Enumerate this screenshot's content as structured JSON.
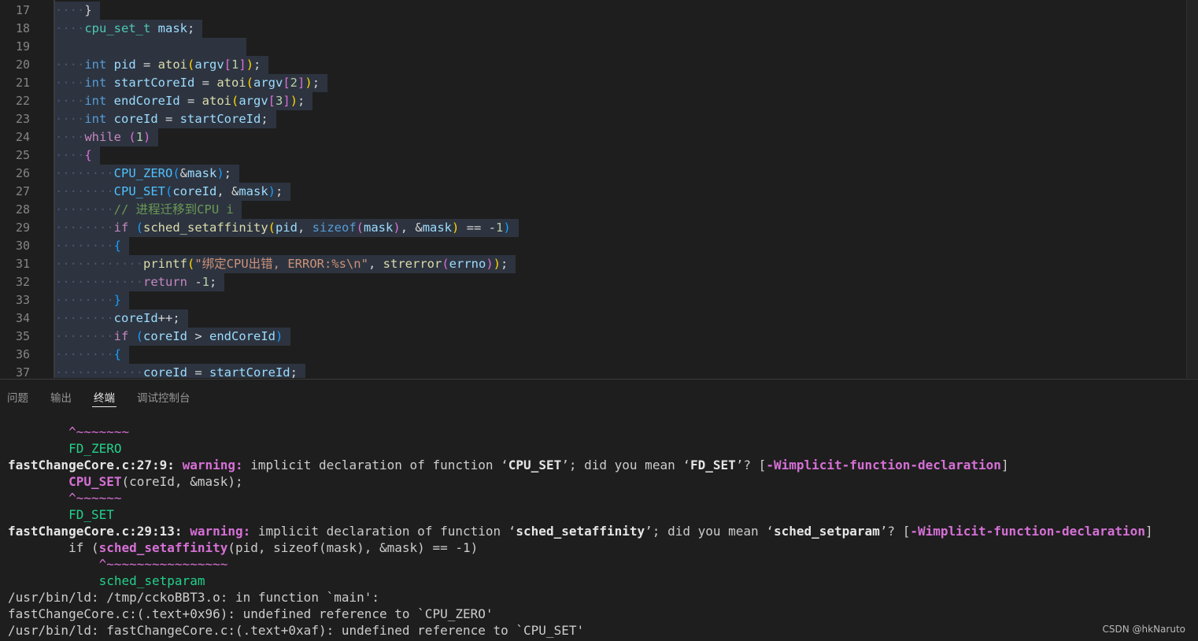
{
  "editor": {
    "line_numbers": [
      "17",
      "18",
      "19",
      "20",
      "21",
      "22",
      "23",
      "24",
      "25",
      "26",
      "27",
      "28",
      "29",
      "30",
      "31",
      "32",
      "33",
      "34",
      "35",
      "36",
      "37"
    ],
    "lines": [
      {
        "indent": 1,
        "tokens": [
          [
            "p",
            "}"
          ]
        ]
      },
      {
        "indent": 1,
        "tokens": [
          [
            "t",
            "cpu_set_t"
          ],
          [
            "p",
            " "
          ],
          [
            "v",
            "mask"
          ],
          [
            "p",
            ";"
          ]
        ]
      },
      {
        "indent": 0,
        "tokens": []
      },
      {
        "indent": 1,
        "tokens": [
          [
            "k",
            "int"
          ],
          [
            "p",
            " "
          ],
          [
            "v",
            "pid"
          ],
          [
            "p",
            " = "
          ],
          [
            "f",
            "atoi"
          ],
          [
            "b1",
            "("
          ],
          [
            "v",
            "argv"
          ],
          [
            "b2",
            "["
          ],
          [
            "n",
            "1"
          ],
          [
            "b2",
            "]"
          ],
          [
            "b1",
            ")"
          ],
          [
            "p",
            ";"
          ]
        ]
      },
      {
        "indent": 1,
        "tokens": [
          [
            "k",
            "int"
          ],
          [
            "p",
            " "
          ],
          [
            "v",
            "startCoreId"
          ],
          [
            "p",
            " = "
          ],
          [
            "f",
            "atoi"
          ],
          [
            "b1",
            "("
          ],
          [
            "v",
            "argv"
          ],
          [
            "b2",
            "["
          ],
          [
            "n",
            "2"
          ],
          [
            "b2",
            "]"
          ],
          [
            "b1",
            ")"
          ],
          [
            "p",
            ";"
          ]
        ]
      },
      {
        "indent": 1,
        "tokens": [
          [
            "k",
            "int"
          ],
          [
            "p",
            " "
          ],
          [
            "v",
            "endCoreId"
          ],
          [
            "p",
            " = "
          ],
          [
            "f",
            "atoi"
          ],
          [
            "b1",
            "("
          ],
          [
            "v",
            "argv"
          ],
          [
            "b2",
            "["
          ],
          [
            "n",
            "3"
          ],
          [
            "b2",
            "]"
          ],
          [
            "b1",
            ")"
          ],
          [
            "p",
            ";"
          ]
        ]
      },
      {
        "indent": 1,
        "tokens": [
          [
            "k",
            "int"
          ],
          [
            "p",
            " "
          ],
          [
            "v",
            "coreId"
          ],
          [
            "p",
            " = "
          ],
          [
            "v",
            "startCoreId"
          ],
          [
            "p",
            ";"
          ]
        ]
      },
      {
        "indent": 1,
        "tokens": [
          [
            "kp",
            "while"
          ],
          [
            "p",
            " "
          ],
          [
            "b2",
            "("
          ],
          [
            "n",
            "1"
          ],
          [
            "b2",
            ")"
          ]
        ]
      },
      {
        "indent": 1,
        "tokens": [
          [
            "b2",
            "{"
          ]
        ]
      },
      {
        "indent": 2,
        "tokens": [
          [
            "m",
            "CPU_ZERO"
          ],
          [
            "b3",
            "("
          ],
          [
            "p",
            "&"
          ],
          [
            "v",
            "mask"
          ],
          [
            "b3",
            ")"
          ],
          [
            "p",
            ";"
          ]
        ]
      },
      {
        "indent": 2,
        "tokens": [
          [
            "m",
            "CPU_SET"
          ],
          [
            "b3",
            "("
          ],
          [
            "v",
            "coreId"
          ],
          [
            "p",
            ", &"
          ],
          [
            "v",
            "mask"
          ],
          [
            "b3",
            ")"
          ],
          [
            "p",
            ";"
          ]
        ]
      },
      {
        "indent": 2,
        "tokens": [
          [
            "c",
            "// 进程迁移到CPU i"
          ]
        ]
      },
      {
        "indent": 2,
        "tokens": [
          [
            "kp",
            "if"
          ],
          [
            "p",
            " "
          ],
          [
            "b3",
            "("
          ],
          [
            "f",
            "sched_setaffinity"
          ],
          [
            "b1",
            "("
          ],
          [
            "v",
            "pid"
          ],
          [
            "p",
            ", "
          ],
          [
            "k",
            "sizeof"
          ],
          [
            "b2",
            "("
          ],
          [
            "v",
            "mask"
          ],
          [
            "b2",
            ")"
          ],
          [
            "p",
            ", &"
          ],
          [
            "v",
            "mask"
          ],
          [
            "b1",
            ")"
          ],
          [
            "p",
            " == -"
          ],
          [
            "n",
            "1"
          ],
          [
            "b3",
            ")"
          ]
        ]
      },
      {
        "indent": 2,
        "tokens": [
          [
            "b3",
            "{"
          ]
        ]
      },
      {
        "indent": 3,
        "tokens": [
          [
            "f",
            "printf"
          ],
          [
            "b1",
            "("
          ],
          [
            "s",
            "\"绑定CPU出错, ERROR:%s\\n\""
          ],
          [
            "p",
            ", "
          ],
          [
            "f",
            "strerror"
          ],
          [
            "b2",
            "("
          ],
          [
            "v",
            "errno"
          ],
          [
            "b2",
            ")"
          ],
          [
            "b1",
            ")"
          ],
          [
            "p",
            ";"
          ]
        ]
      },
      {
        "indent": 3,
        "tokens": [
          [
            "kp",
            "return"
          ],
          [
            "p",
            " -"
          ],
          [
            "n",
            "1"
          ],
          [
            "p",
            ";"
          ]
        ]
      },
      {
        "indent": 2,
        "tokens": [
          [
            "b3",
            "}"
          ]
        ]
      },
      {
        "indent": 2,
        "tokens": [
          [
            "v",
            "coreId"
          ],
          [
            "p",
            "++;"
          ]
        ]
      },
      {
        "indent": 2,
        "tokens": [
          [
            "kp",
            "if"
          ],
          [
            "p",
            " "
          ],
          [
            "b3",
            "("
          ],
          [
            "v",
            "coreId"
          ],
          [
            "p",
            " > "
          ],
          [
            "v",
            "endCoreId"
          ],
          [
            "b3",
            ")"
          ]
        ]
      },
      {
        "indent": 2,
        "tokens": [
          [
            "b3",
            "{"
          ]
        ]
      },
      {
        "indent": 3,
        "tokens": [
          [
            "v",
            "coreId"
          ],
          [
            "p",
            " = "
          ],
          [
            "v",
            "startCoreId"
          ],
          [
            "p",
            ";"
          ]
        ]
      }
    ]
  },
  "panel": {
    "tabs": [
      "问题",
      "输出",
      "终端",
      "调试控制台"
    ],
    "active_tab": "终端"
  },
  "terminal": {
    "lines": [
      [
        [
          "mag",
          "        ^~~~~~~~"
        ]
      ],
      [
        [
          "grn",
          "        FD_ZERO"
        ]
      ],
      [
        [
          "b",
          "fastChangeCore.c:27:9: "
        ],
        [
          "mgb",
          "warning: "
        ],
        [
          "plain",
          "implicit declaration of function ‘"
        ],
        [
          "b",
          "CPU_SET"
        ],
        [
          "plain",
          "’; did you mean ‘"
        ],
        [
          "b",
          "FD_SET"
        ],
        [
          "plain",
          "’? ["
        ],
        [
          "mgb",
          "-Wimplicit-function-declaration"
        ],
        [
          "plain",
          "]"
        ]
      ],
      [
        [
          "plain",
          "        "
        ],
        [
          "mgb",
          "CPU_SET"
        ],
        [
          "plain",
          "(coreId, &mask);"
        ]
      ],
      [
        [
          "mag",
          "        ^~~~~~~"
        ]
      ],
      [
        [
          "grn",
          "        FD_SET"
        ]
      ],
      [
        [
          "b",
          "fastChangeCore.c:29:13: "
        ],
        [
          "mgb",
          "warning: "
        ],
        [
          "plain",
          "implicit declaration of function ‘"
        ],
        [
          "b",
          "sched_setaffinity"
        ],
        [
          "plain",
          "’; did you mean ‘"
        ],
        [
          "b",
          "sched_setparam"
        ],
        [
          "plain",
          "’? ["
        ],
        [
          "mgb",
          "-Wimplicit-function-declaration"
        ],
        [
          "plain",
          "]"
        ]
      ],
      [
        [
          "plain",
          "        if ("
        ],
        [
          "mgb",
          "sched_setaffinity"
        ],
        [
          "plain",
          "(pid, sizeof(mask), &mask) == -1)"
        ]
      ],
      [
        [
          "mag",
          "            ^~~~~~~~~~~~~~~~~"
        ]
      ],
      [
        [
          "grn",
          "            sched_setparam"
        ]
      ],
      [
        [
          "plain",
          "/usr/bin/ld: /tmp/cckoBBT3.o: in function `main':"
        ]
      ],
      [
        [
          "plain",
          "fastChangeCore.c:(.text+0x96): undefined reference to `CPU_ZERO'"
        ]
      ],
      [
        [
          "plain",
          "/usr/bin/ld: fastChangeCore.c:(.text+0xaf): undefined reference to `CPU_SET'"
        ]
      ]
    ]
  },
  "watermark": "CSDN @hkNaruto"
}
